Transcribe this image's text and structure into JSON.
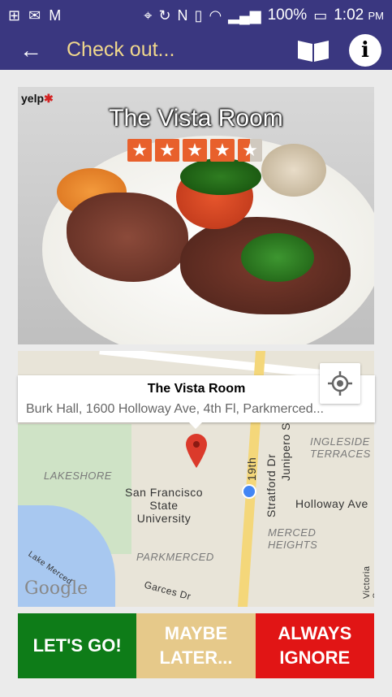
{
  "statusbar": {
    "battery": "100%",
    "time": "1:02",
    "ampm": "PM"
  },
  "appbar": {
    "title": "Check out...",
    "back_icon": "arrow-left-icon",
    "book_icon": "open-book-icon",
    "info_icon": "info-icon",
    "info_glyph": "i"
  },
  "venue": {
    "name": "The Vista Room",
    "rating": 4.5,
    "yelp_label": "yelp"
  },
  "map": {
    "callout_title": "The Vista Room",
    "callout_address": "Burk Hall, 1600 Holloway Ave, 4th Fl, Parkmerced...",
    "labels": {
      "lakeshore": "LAKESHORE",
      "sfsu": "San Francisco State University",
      "parkmerced": "PARKMERCED",
      "merced_heights": "MERCED HEIGHTS",
      "ingleside_terraces": "INGLESIDE TERRACES",
      "holloway": "Holloway Ave",
      "stratford": "Stratford Dr",
      "junipero": "Junipero S",
      "nineteenth": "19th",
      "lake_merced": "Lake Merced",
      "garces": "Garces Dr",
      "victoria": "Victoria S",
      "google": "Google"
    }
  },
  "actions": {
    "go": "LET'S GO!",
    "later": "MAYBE LATER...",
    "ignore": "ALWAYS IGNORE"
  },
  "colors": {
    "appbar": "#3a3780",
    "title": "#f0d78c",
    "go": "#0e7c18",
    "later": "#e6c98a",
    "ignore": "#e11515"
  }
}
